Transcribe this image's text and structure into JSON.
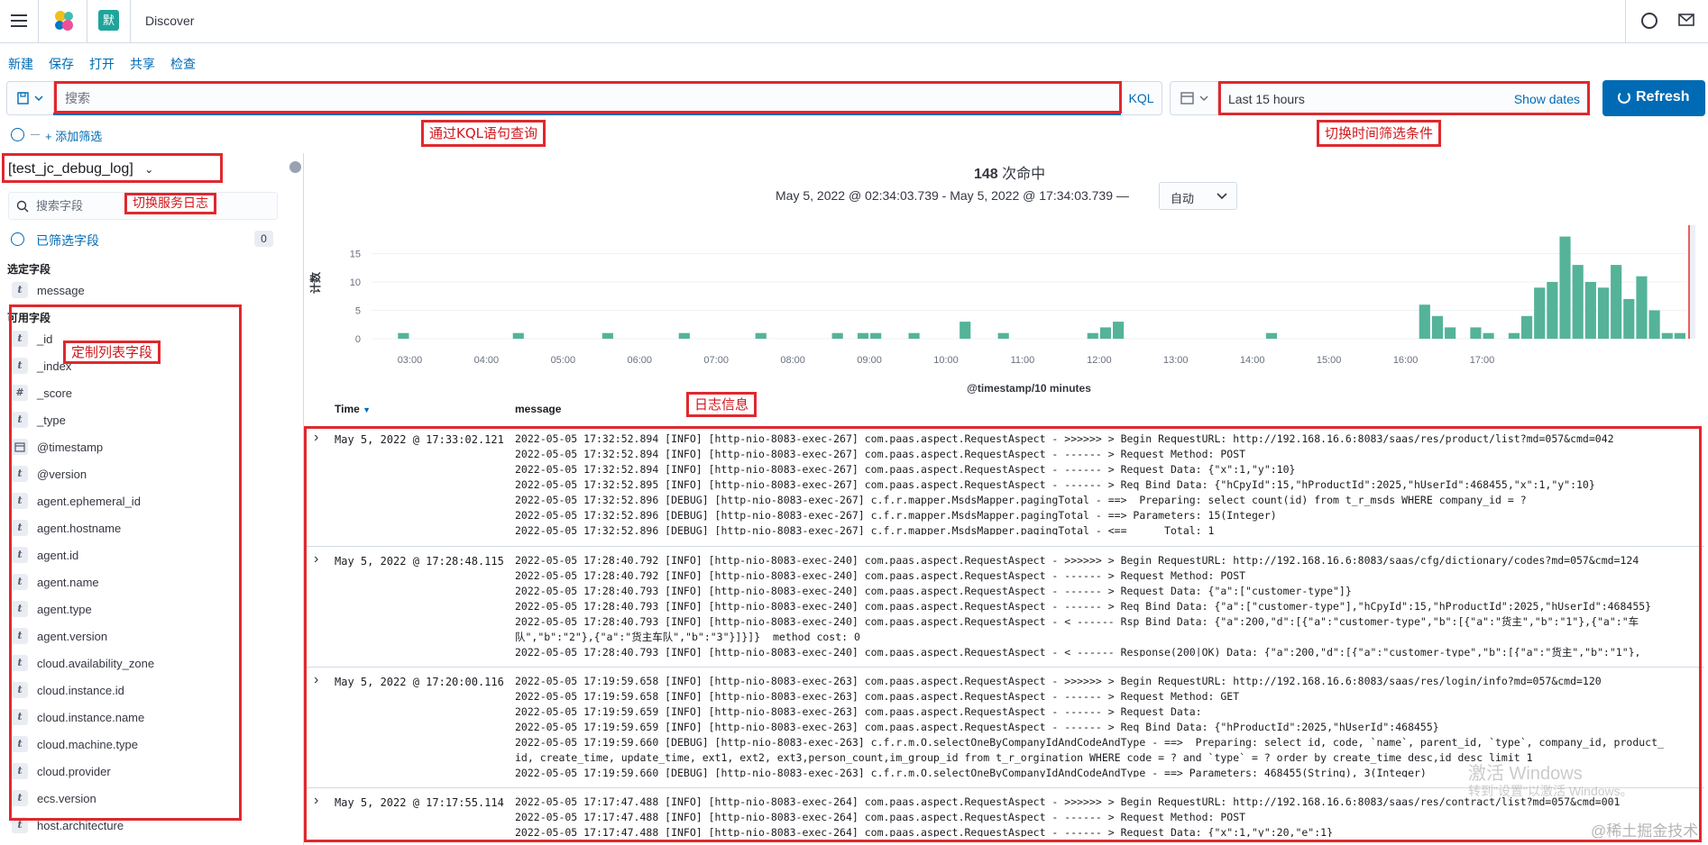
{
  "header": {
    "breadcrumb": "Discover",
    "space_initial": "默"
  },
  "menu": {
    "new": "新建",
    "save": "保存",
    "open": "打开",
    "share": "共享",
    "inspect": "检查"
  },
  "query": {
    "placeholder": "搜索",
    "language": "KQL"
  },
  "time": {
    "label": "Last 15 hours",
    "show_dates": "Show dates",
    "refresh": "Refresh"
  },
  "filters": {
    "add_filter": "+ 添加筛选"
  },
  "annotations": {
    "kql": "通过KQL语句查询",
    "time": "切换时间筛选条件",
    "service": "切换服务日志",
    "fields": "定制列表字段",
    "log": "日志信息"
  },
  "sidebar": {
    "index_pattern": "[test_jc_debug_log]",
    "search_placeholder": "搜索字段",
    "selected_filters": "已筛选字段",
    "selected_filters_count": "0",
    "selected_section": "选定字段",
    "selected_fields": [
      {
        "type": "t",
        "name": "message"
      }
    ],
    "available_section": "可用字段",
    "available_fields": [
      {
        "type": "t",
        "name": "_id"
      },
      {
        "type": "t",
        "name": "_index"
      },
      {
        "type": "#",
        "name": "_score"
      },
      {
        "type": "t",
        "name": "_type"
      },
      {
        "type": "cal",
        "name": "@timestamp"
      },
      {
        "type": "t",
        "name": "@version"
      },
      {
        "type": "t",
        "name": "agent.ephemeral_id"
      },
      {
        "type": "t",
        "name": "agent.hostname"
      },
      {
        "type": "t",
        "name": "agent.id"
      },
      {
        "type": "t",
        "name": "agent.name"
      },
      {
        "type": "t",
        "name": "agent.type"
      },
      {
        "type": "t",
        "name": "agent.version"
      },
      {
        "type": "t",
        "name": "cloud.availability_zone"
      },
      {
        "type": "t",
        "name": "cloud.instance.id"
      },
      {
        "type": "t",
        "name": "cloud.instance.name"
      },
      {
        "type": "t",
        "name": "cloud.machine.type"
      },
      {
        "type": "t",
        "name": "cloud.provider"
      },
      {
        "type": "t",
        "name": "ecs.version"
      },
      {
        "type": "t",
        "name": "host.architecture"
      }
    ]
  },
  "summary": {
    "hits": "148",
    "hits_label": "次命中",
    "range": "May 5, 2022 @ 02:34:03.739 - May 5, 2022 @ 17:34:03.739 —",
    "interval": "自动"
  },
  "chart_data": {
    "type": "bar",
    "xlabel": "@timestamp/10 minutes",
    "ylabel": "计数",
    "ylim": [
      0,
      20
    ],
    "yticks": [
      0,
      5,
      10,
      15
    ],
    "xtick_labels": [
      "03:00",
      "04:00",
      "05:00",
      "06:00",
      "07:00",
      "08:00",
      "09:00",
      "10:00",
      "11:00",
      "12:00",
      "13:00",
      "14:00",
      "15:00",
      "16:00",
      "17:00"
    ],
    "x_start": "02:30",
    "bin_minutes": 10,
    "values": [
      0,
      0,
      1,
      0,
      0,
      0,
      0,
      0,
      0,
      0,
      0,
      1,
      0,
      0,
      0,
      0,
      0,
      0,
      1,
      0,
      0,
      0,
      0,
      0,
      1,
      0,
      0,
      0,
      0,
      0,
      1,
      0,
      0,
      0,
      0,
      0,
      1,
      0,
      1,
      1,
      0,
      0,
      1,
      0,
      0,
      0,
      3,
      0,
      0,
      1,
      0,
      0,
      0,
      0,
      0,
      0,
      1,
      2,
      3,
      0,
      0,
      0,
      0,
      0,
      0,
      0,
      0,
      0,
      0,
      0,
      1,
      0,
      0,
      0,
      0,
      0,
      0,
      0,
      0,
      0,
      0,
      0,
      6,
      4,
      2,
      0,
      2,
      1,
      0,
      1,
      4,
      9,
      10,
      18,
      13,
      10,
      9,
      13,
      7,
      11,
      5,
      1,
      1
    ]
  },
  "table": {
    "col_time": "Time",
    "col_message": "message",
    "rows": [
      {
        "time": "May 5, 2022 @ 17:33:02.121",
        "lines": [
          "2022-05-05 17:32:52.894 [INFO] [http-nio-8083-exec-267] com.paas.aspect.RequestAspect - >>>>>> > Begin RequestURL: http://192.168.16.6:8083/saas/res/product/list?md=057&cmd=042",
          "2022-05-05 17:32:52.894 [INFO] [http-nio-8083-exec-267] com.paas.aspect.RequestAspect - ------ > Request Method: POST",
          "2022-05-05 17:32:52.894 [INFO] [http-nio-8083-exec-267] com.paas.aspect.RequestAspect - ------ > Request Data: {\"x\":1,\"y\":10}",
          "2022-05-05 17:32:52.895 [INFO] [http-nio-8083-exec-267] com.paas.aspect.RequestAspect - ------ > Req Bind Data: {\"hCpyId\":15,\"hProductId\":2025,\"hUserId\":468455,\"x\":1,\"y\":10}",
          "2022-05-05 17:32:52.896 [DEBUG] [http-nio-8083-exec-267] c.f.r.mapper.MsdsMapper.pagingTotal - ==>  Preparing: select count(id) from t_r_msds WHERE company_id = ?",
          "2022-05-05 17:32:52.896 [DEBUG] [http-nio-8083-exec-267] c.f.r.mapper.MsdsMapper.pagingTotal - ==> Parameters: 15(Integer)",
          "2022-05-05 17:32:52.896 [DEBUG] [http-nio-8083-exec-267] c.f.r.mapper.MsdsMapper.pagingTotal - <==      Total: 1"
        ]
      },
      {
        "time": "May 5, 2022 @ 17:28:48.115",
        "lines": [
          "2022-05-05 17:28:40.792 [INFO] [http-nio-8083-exec-240] com.paas.aspect.RequestAspect - >>>>>> > Begin RequestURL: http://192.168.16.6:8083/saas/cfg/dictionary/codes?md=057&cmd=124",
          "2022-05-05 17:28:40.792 [INFO] [http-nio-8083-exec-240] com.paas.aspect.RequestAspect - ------ > Request Method: POST",
          "2022-05-05 17:28:40.793 [INFO] [http-nio-8083-exec-240] com.paas.aspect.RequestAspect - ------ > Request Data: {\"a\":[\"customer-type\"]}",
          "2022-05-05 17:28:40.793 [INFO] [http-nio-8083-exec-240] com.paas.aspect.RequestAspect - ------ > Req Bind Data: {\"a\":[\"customer-type\"],\"hCpyId\":15,\"hProductId\":2025,\"hUserId\":468455}",
          "2022-05-05 17:28:40.793 [INFO] [http-nio-8083-exec-240] com.paas.aspect.RequestAspect - < ------ Rsp Bind Data: {\"a\":200,\"d\":[{\"a\":\"customer-type\",\"b\":[{\"a\":\"货主\",\"b\":\"1\"},{\"a\":\"车",
          "队\",\"b\":\"2\"},{\"a\":\"货主车队\",\"b\":\"3\"}]}]}  method cost: 0",
          "2022-05-05 17:28:40.793 [INFO] [http-nio-8083-exec-240] com.paas.aspect.RequestAspect - < ------ Response(200|OK) Data: {\"a\":200,\"d\":[{\"a\":\"customer-type\",\"b\":[{\"a\":\"货主\",\"b\":\"1\"},"
        ]
      },
      {
        "time": "May 5, 2022 @ 17:20:00.116",
        "lines": [
          "2022-05-05 17:19:59.658 [INFO] [http-nio-8083-exec-263] com.paas.aspect.RequestAspect - >>>>>> > Begin RequestURL: http://192.168.16.6:8083/saas/res/login/info?md=057&cmd=120",
          "2022-05-05 17:19:59.658 [INFO] [http-nio-8083-exec-263] com.paas.aspect.RequestAspect - ------ > Request Method: GET",
          "2022-05-05 17:19:59.659 [INFO] [http-nio-8083-exec-263] com.paas.aspect.RequestAspect - ------ > Request Data:",
          "2022-05-05 17:19:59.659 [INFO] [http-nio-8083-exec-263] com.paas.aspect.RequestAspect - ------ > Req Bind Data: {\"hProductId\":2025,\"hUserId\":468455}",
          "2022-05-05 17:19:59.660 [DEBUG] [http-nio-8083-exec-263] c.f.r.m.O.selectOneByCompanyIdAndCodeAndType - ==>  Preparing: select id, code, `name`, parent_id, `type`, company_id, product_",
          "id, create_time, update_time, ext1, ext2, ext3,person_count,im_group_id from t_r_orgination WHERE code = ? and `type` = ? order by create_time desc,id desc limit 1",
          "2022-05-05 17:19:59.660 [DEBUG] [http-nio-8083-exec-263] c.f.r.m.O.selectOneByCompanyIdAndCodeAndType - ==> Parameters: 468455(String), 3(Integer)"
        ]
      },
      {
        "time": "May 5, 2022 @ 17:17:55.114",
        "lines": [
          "2022-05-05 17:17:47.488 [INFO] [http-nio-8083-exec-264] com.paas.aspect.RequestAspect - >>>>>> > Begin RequestURL: http://192.168.16.6:8083/saas/res/contract/list?md=057&cmd=001",
          "2022-05-05 17:17:47.488 [INFO] [http-nio-8083-exec-264] com.paas.aspect.RequestAspect - ------ > Request Method: POST",
          "2022-05-05 17:17:47.488 [INFO] [http-nio-8083-exec-264] com.paas.aspect.RequestAspect - ------ > Request Data: {\"x\":1,\"y\":20,\"e\":1}"
        ]
      }
    ]
  },
  "watermark": {
    "line1": "激活 Windows",
    "line2": "转到\"设置\"以激活 Windows。",
    "brand": "@稀土掘金技术社区"
  },
  "colors": {
    "accent": "#006bb4",
    "bar": "#54b399",
    "annotation": "#e0282e"
  }
}
